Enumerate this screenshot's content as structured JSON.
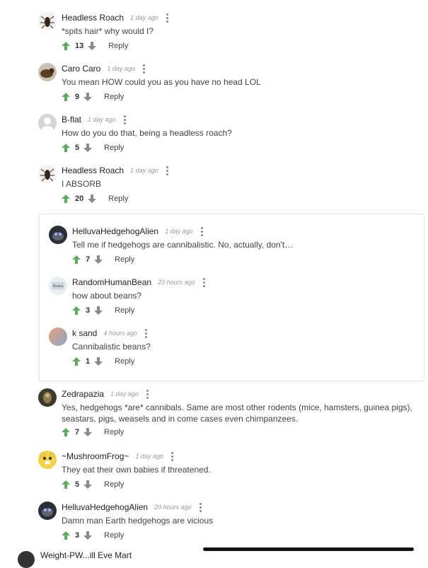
{
  "colors": {
    "upvote": "#5dab5d",
    "downvote": "#8a8a8a",
    "text": "#444444"
  },
  "labels": {
    "reply": "Reply"
  },
  "comments": [
    {
      "author": "Headless Roach",
      "time": "1 day ago",
      "text": "*spits hair* why would I?",
      "votes": "13",
      "avatar": "roach-avatar"
    },
    {
      "author": "Caro Caro",
      "time": "1 day ago",
      "text": "You mean HOW could you as you have no head LOL",
      "votes": "9",
      "avatar": "caro-avatar"
    },
    {
      "author": "B-flat",
      "time": "1 day ago",
      "text": "How do you do that, being a headless roach?",
      "votes": "5",
      "avatar": "default-avatar"
    },
    {
      "author": "Headless Roach",
      "time": "1 day ago",
      "text": "I ABSORB",
      "votes": "20",
      "avatar": "roach-avatar"
    },
    {
      "author": "HelluvaHedgehogAlien",
      "time": "1 day ago",
      "text": "Tell me if hedgehogs are cannibalistic. No, actually, don't…",
      "votes": "7",
      "avatar": "hedgehog-avatar"
    },
    {
      "author": "RandomHumanBean",
      "time": "23 hours ago",
      "text": "how about beans?",
      "votes": "3",
      "avatar": "bean-avatar"
    },
    {
      "author": "k sand",
      "time": "4 hours ago",
      "text": "Cannibalistic beans?",
      "votes": "1",
      "avatar": "sand-avatar"
    },
    {
      "author": "Zedrapazia",
      "time": "1 day ago",
      "text": "Yes, hedgehogs *are* cannibals. Same are most other rodents (mice, hamsters, guinea pigs), seastars, pigs, weasels and in come cases even chimpanzees.",
      "votes": "7",
      "avatar": "zedra-avatar"
    },
    {
      "author": "~MushroomFrog~",
      "time": "1 day ago",
      "text": "They eat their own babies if threatened.",
      "votes": "5",
      "avatar": "frog-avatar"
    },
    {
      "author": "HelluvaHedgehogAlien",
      "time": "20 hours ago",
      "text": "Damn man Earth hedgehogs are vicious",
      "votes": "3",
      "avatar": "hedgehog-avatar"
    }
  ],
  "partial_next": {
    "author": "Weight-PW...ill Eve Mart"
  }
}
